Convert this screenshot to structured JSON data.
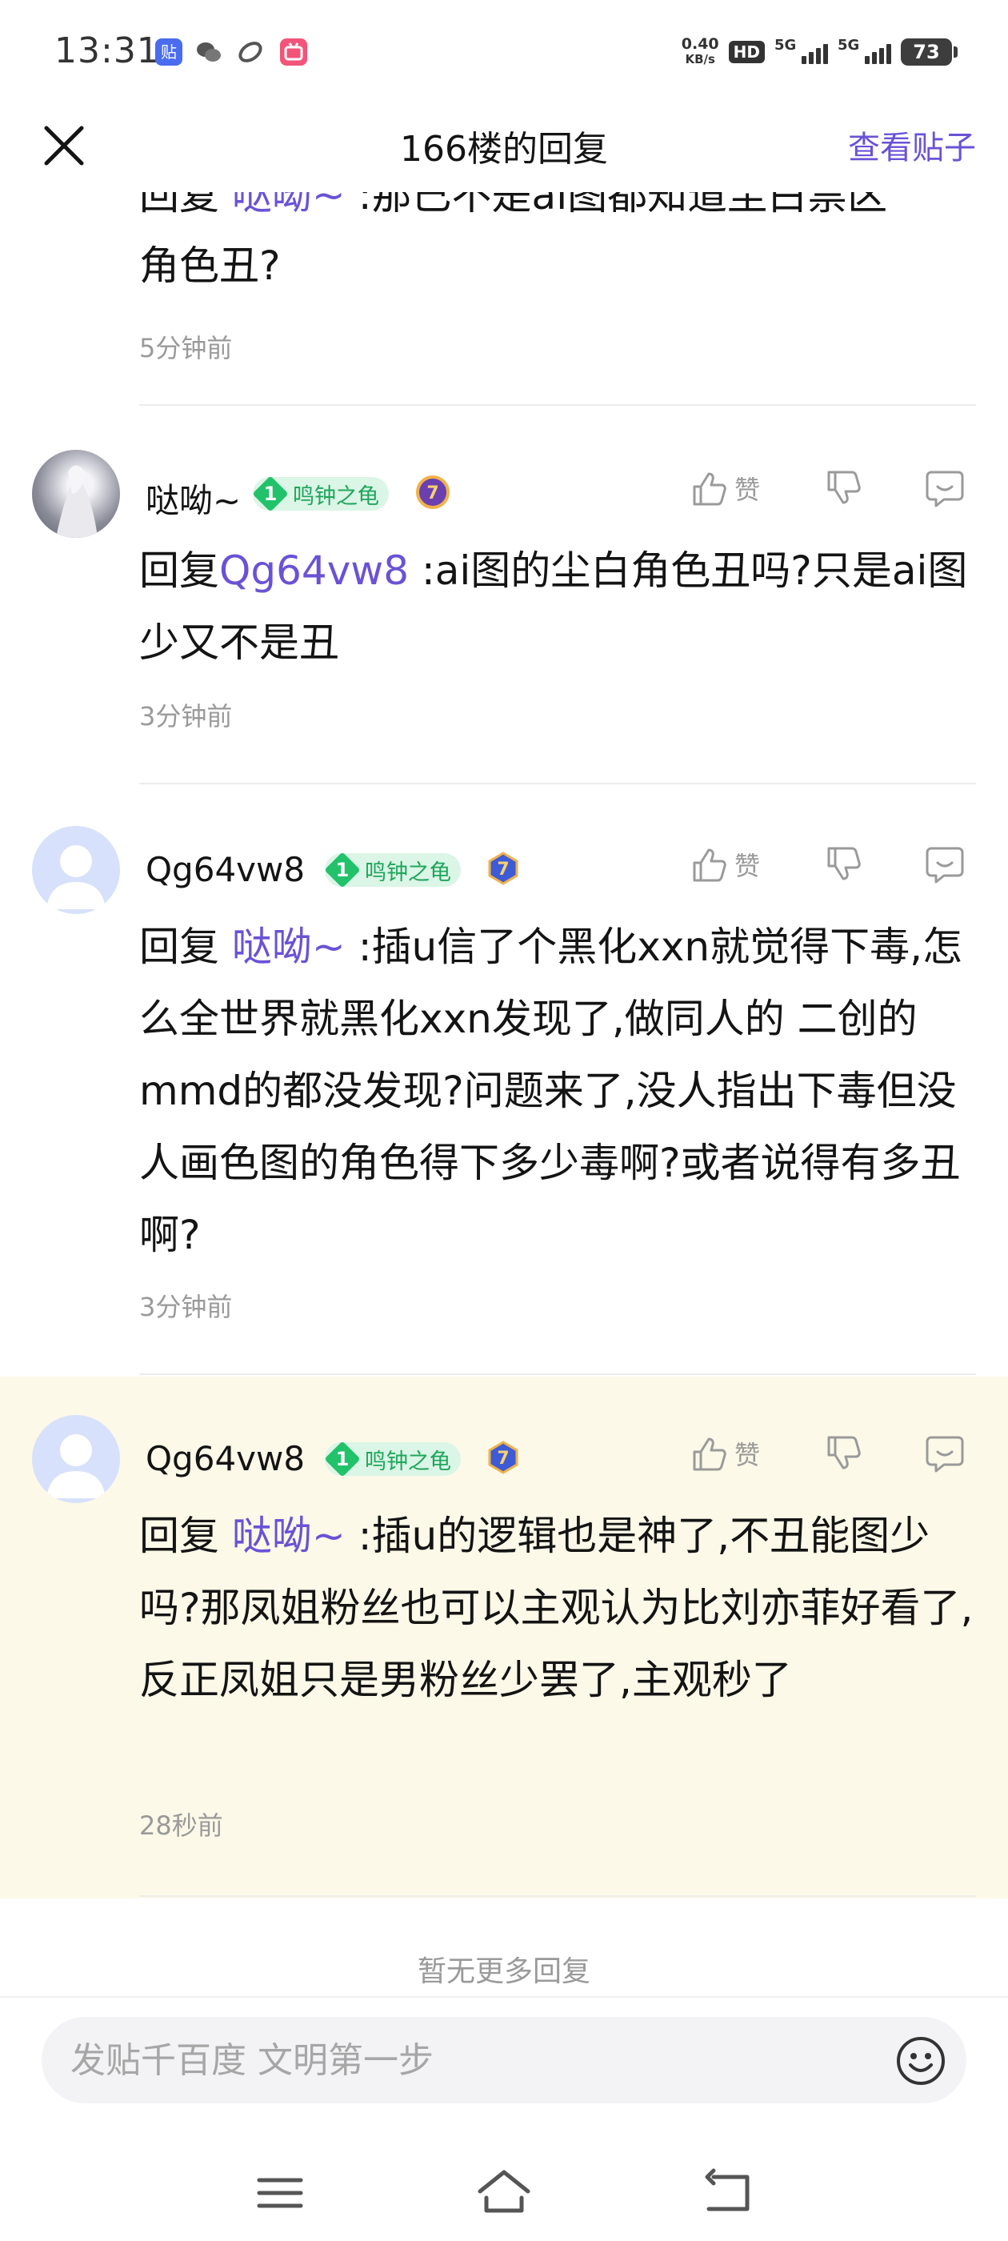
{
  "status_bar": {
    "time": "13:31",
    "apps": [
      "贴",
      "wechat",
      "sync",
      "bilibili"
    ],
    "net_speed_value": "0.40",
    "net_speed_unit": "KB/s",
    "hd": "HD",
    "signal_1": "5G",
    "signal_2": "5G",
    "battery": "73"
  },
  "header": {
    "title": "166楼的回复",
    "view_post": "查看贴子"
  },
  "partial_reply": {
    "line1_prefix": "回复 ",
    "line1_mention": "哒呦~",
    "line1_rest": " :那已不是ai图都知道尘白禁区",
    "line2": "角色丑?",
    "time": "5分钟前"
  },
  "replies": [
    {
      "username": "哒呦~",
      "level": "1",
      "badge": "鸣钟之龟",
      "reply_prefix": "回复",
      "mention": "Qg64vw8",
      "text": " :ai图的尘白角色丑吗?只是ai图少又不是丑",
      "time": "3分钟前",
      "like_label": "赞"
    },
    {
      "username": "Qg64vw8",
      "level": "1",
      "badge": "鸣钟之龟",
      "reply_prefix": "回复 ",
      "mention": "哒呦~",
      "text": " :插u信了个黑化xxn就觉得下毒,怎么全世界就黑化xxn发现了,做同人的 二创的mmd的都没发现?问题来了,没人指出下毒但没人画色图的角色得下多少毒啊?或者说得有多丑啊?",
      "time": "3分钟前",
      "like_label": "赞"
    },
    {
      "username": "Qg64vw8",
      "level": "1",
      "badge": "鸣钟之龟",
      "reply_prefix": "回复 ",
      "mention": "哒呦~",
      "text": " :插u的逻辑也是神了,不丑能图少吗?那凤姐粉丝也可以主观认为比刘亦菲好看了,反正凤姐只是男粉丝少罢了,主观秒了",
      "time": "28秒前",
      "like_label": "赞"
    }
  ],
  "footer": {
    "no_more": "暂无更多回复",
    "composer_placeholder": "发贴千百度 文明第一步"
  },
  "colors": {
    "accent": "#6a52d6",
    "highlight_bg": "#fcf9e8",
    "badge_green": "#22c26b"
  },
  "icons": [
    "close-icon",
    "like-icon",
    "dislike-icon",
    "comment-icon",
    "emoji-icon",
    "menu-icon",
    "home-icon",
    "back-icon"
  ]
}
